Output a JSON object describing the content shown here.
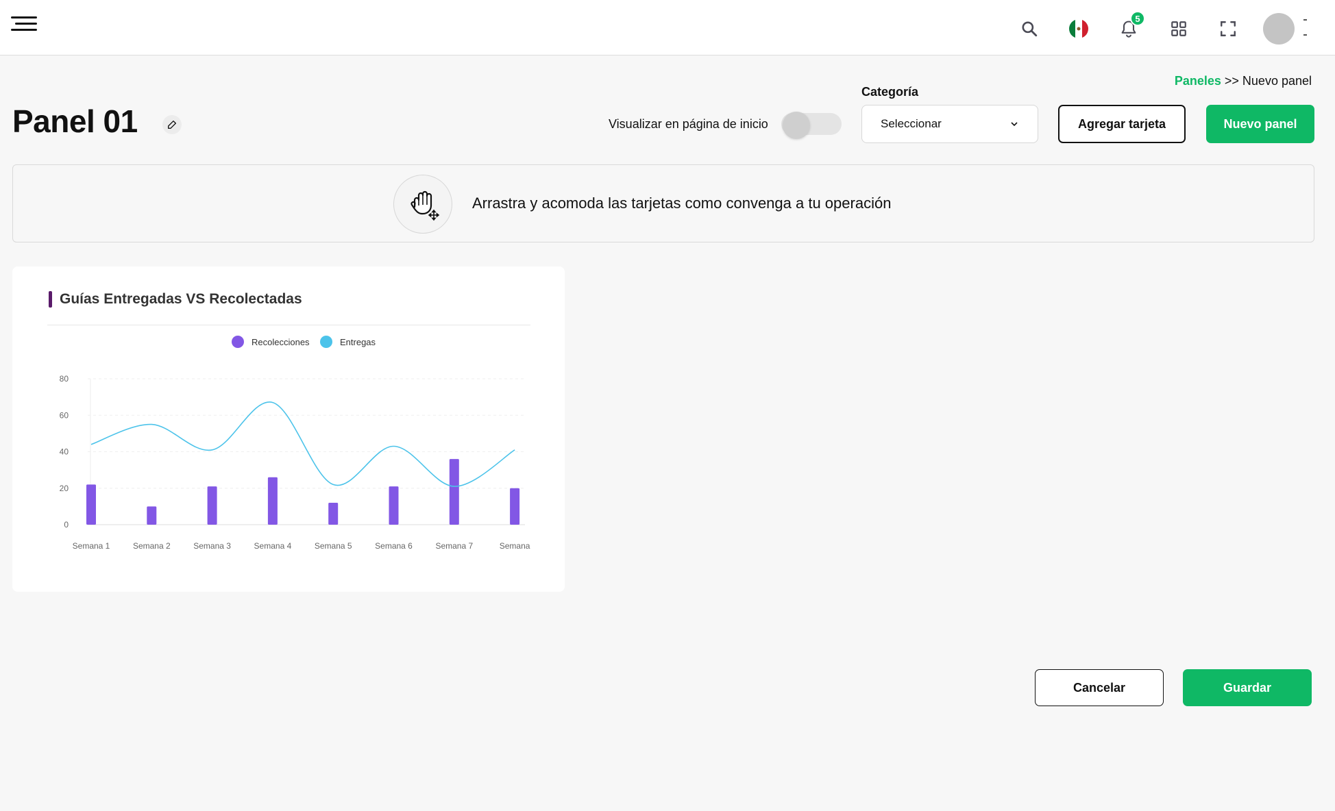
{
  "topbar": {
    "notifications_count": "5",
    "icons": [
      "hamburger-icon",
      "search-icon",
      "mexico-flag-icon",
      "bell-icon",
      "apps-grid-icon",
      "fullscreen-icon"
    ]
  },
  "breadcrumb": {
    "link": "Paneles",
    "separator": ">>",
    "current": "Nuevo panel"
  },
  "header": {
    "title": "Panel 01",
    "toggle_label": "Visualizar en página de inicio",
    "toggle_on": false,
    "category_label": "Categoría",
    "category_value": "Seleccionar",
    "add_card_label": "Agregar tarjeta",
    "new_panel_label": "Nuevo panel"
  },
  "hint": {
    "text": "Arrastra y acomoda las tarjetas como  convenga a tu operación"
  },
  "card": {
    "title": "Guías Entregadas VS Recolectadas"
  },
  "chart_data": {
    "type": "bar+line",
    "title": "Guías Entregadas VS Recolectadas",
    "categories": [
      "Semana 1",
      "Semana 2",
      "Semana 3",
      "Semana 4",
      "Semana 5",
      "Semana 6",
      "Semana 7",
      "Semana"
    ],
    "series": [
      {
        "name": "Recolecciones",
        "type": "bar",
        "color": "#8257e5",
        "values": [
          22,
          10,
          21,
          26,
          12,
          21,
          36,
          20
        ]
      },
      {
        "name": "Entregas",
        "type": "line",
        "color": "#4cc3ea",
        "values": [
          44,
          55,
          41,
          67,
          22,
          43,
          21,
          41
        ]
      }
    ],
    "yticks": [
      0,
      20,
      40,
      60,
      80
    ],
    "ylim": [
      0,
      80
    ],
    "legend_position": "top-center",
    "grid": true
  },
  "footer": {
    "cancel_label": "Cancelar",
    "save_label": "Guardar"
  },
  "colors": {
    "brand_green": "#0fb865",
    "title_accent": "#5a1b6a"
  }
}
